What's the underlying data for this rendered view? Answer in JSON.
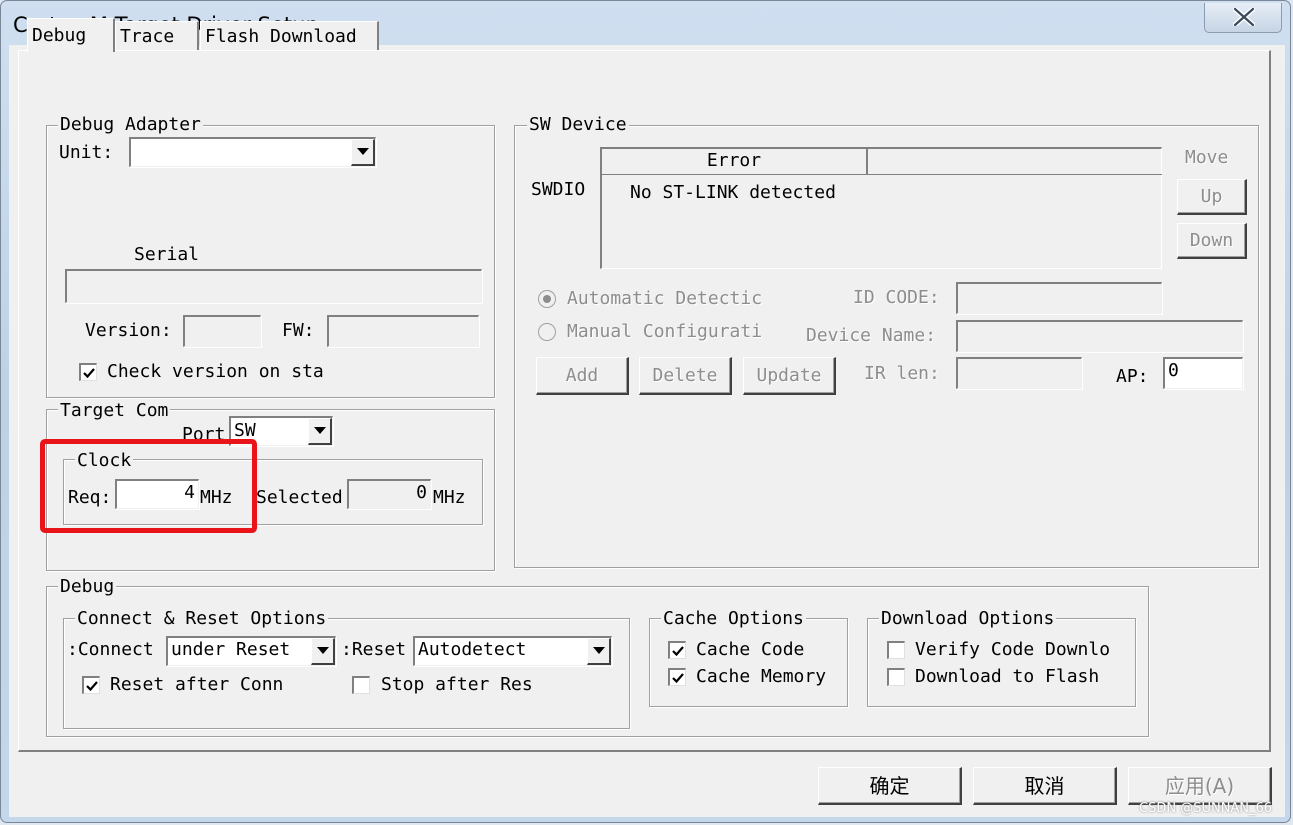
{
  "window": {
    "title": "Cortex-M Target Driver Setup"
  },
  "tabs": [
    "Debug",
    "Trace",
    "Flash Download"
  ],
  "debug_adapter": {
    "legend": "Debug Adapter",
    "unit_label": "Unit:",
    "unit_value": "",
    "serial_label": "Serial",
    "serial_value": "",
    "version_label": "Version:",
    "version_value": "",
    "fw_label": "FW:",
    "fw_value": "",
    "check_version_label": "Check version on sta",
    "check_version_checked": true
  },
  "target_com": {
    "legend": "Target Com",
    "port_label": "Port",
    "port_value": "SW",
    "clock": {
      "legend": "Clock",
      "req_label": "Req:",
      "req_value": "4",
      "req_unit": "MHz",
      "selected_label": "Selected",
      "selected_value": "0",
      "selected_unit": "MHz"
    }
  },
  "sw_device": {
    "legend": "SW Device",
    "swdio_label": "SWDIO",
    "column_header": "Error",
    "row_text": "No ST-LINK detected",
    "move_label": "Move",
    "up_label": "Up",
    "down_label": "Down",
    "auto_detect_label": "Automatic Detectic",
    "manual_config_label": "Manual Configurati",
    "id_code_label": "ID CODE:",
    "device_name_label": "Device Name:",
    "add_label": "Add",
    "delete_label": "Delete",
    "update_label": "Update",
    "ir_len_label": "IR len:",
    "ap_label": "AP:",
    "ap_value": "0"
  },
  "debug_section": {
    "legend": "Debug",
    "connect_reset": {
      "legend": "Connect & Reset Options",
      "connect_label": "Connect:",
      "connect_value": "under Reset",
      "reset_label": "Reset:",
      "reset_value": "Autodetect",
      "reset_after_label": "Reset after Conn",
      "reset_after_checked": true,
      "stop_after_label": "Stop after Res",
      "stop_after_checked": false
    },
    "cache_options": {
      "legend": "Cache Options",
      "cache_code_label": "Cache Code",
      "cache_code_checked": true,
      "cache_memory_label": "Cache Memory",
      "cache_memory_checked": true
    },
    "download_options": {
      "legend": "Download Options",
      "verify_label": "Verify Code Downlo",
      "verify_checked": false,
      "download_flash_label": "Download to Flash",
      "download_flash_checked": false
    }
  },
  "footer": {
    "ok_label": "确定",
    "cancel_label": "取消",
    "apply_label": "应用(A)"
  },
  "watermark": "CSDN @SUNNAN_66"
}
